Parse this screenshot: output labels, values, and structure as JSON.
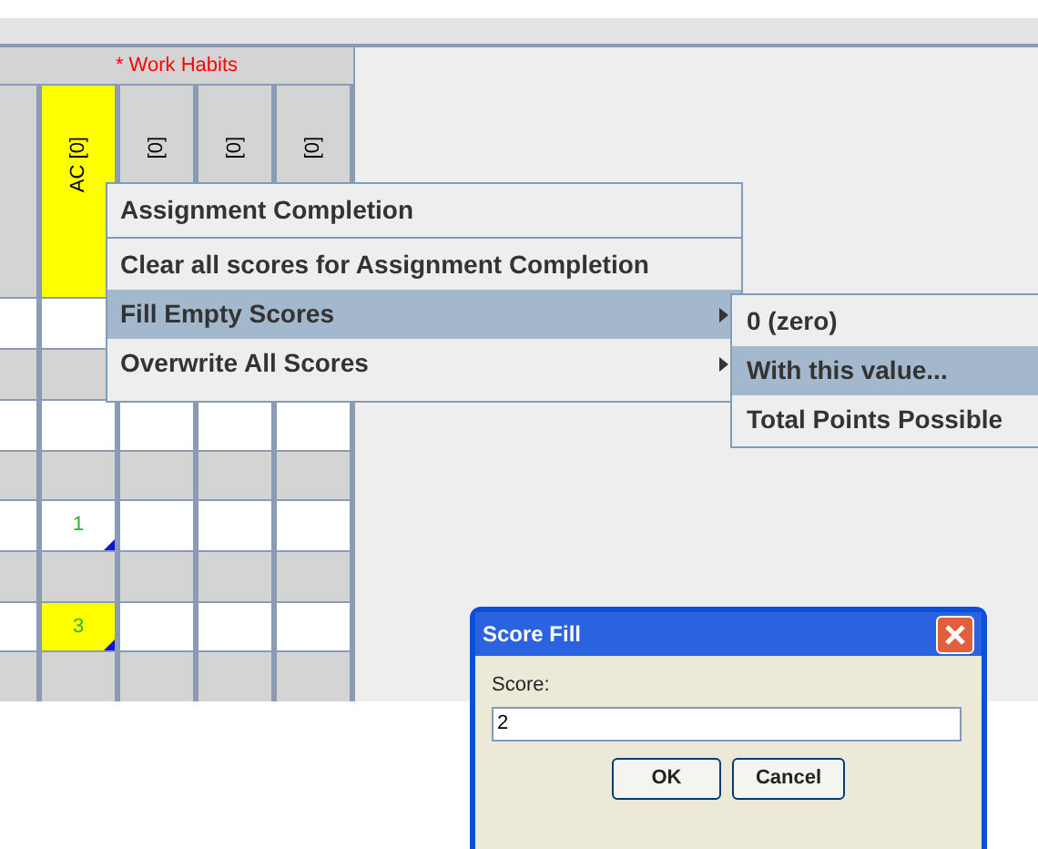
{
  "gradebook": {
    "category": "* Work Habits",
    "columns": [
      {
        "highlighted": false
      },
      {
        "label": "AC [0]",
        "highlighted": true
      },
      {
        "label": "[0]",
        "highlighted": false
      },
      {
        "label": "[0]",
        "highlighted": false
      },
      {
        "label": "[0]",
        "highlighted": false
      }
    ],
    "rows": [
      {
        "cells": [
          {
            "highlighted": false,
            "flagged": false
          },
          {},
          {},
          {},
          {}
        ]
      },
      {
        "cells": [
          {
            "highlighted": false,
            "flagged": false
          },
          {},
          {},
          {},
          {}
        ]
      },
      {
        "cells": [
          {
            "highlighted": false,
            "flagged": false
          },
          {
            "highlighted": false,
            "flagged": false
          },
          {
            "highlighted": false,
            "flagged": false
          },
          {
            "highlighted": false,
            "flagged": false
          },
          {
            "highlighted": false,
            "flagged": false
          }
        ]
      },
      {
        "cells": [
          {
            "highlighted": false,
            "flagged": false
          },
          {
            "highlighted": false,
            "flagged": false
          },
          {
            "highlighted": false,
            "flagged": false
          },
          {
            "highlighted": false,
            "flagged": false
          },
          {
            "highlighted": false,
            "flagged": false
          }
        ]
      },
      {
        "cells": [
          {
            "highlighted": false,
            "flagged": false
          },
          {
            "text": "1",
            "highlighted": false,
            "flagged": true
          },
          {
            "highlighted": false,
            "flagged": false
          },
          {
            "highlighted": false,
            "flagged": false
          },
          {
            "highlighted": false,
            "flagged": false
          }
        ]
      },
      {
        "cells": [
          {
            "highlighted": false,
            "flagged": false
          },
          {
            "highlighted": false,
            "flagged": false
          },
          {
            "highlighted": false,
            "flagged": false
          },
          {
            "highlighted": false,
            "flagged": false
          },
          {
            "highlighted": false,
            "flagged": false
          }
        ]
      },
      {
        "cells": [
          {
            "highlighted": false,
            "flagged": false
          },
          {
            "text": "3",
            "highlighted": true,
            "flagged": true
          },
          {
            "highlighted": false,
            "flagged": false
          },
          {
            "highlighted": false,
            "flagged": false
          },
          {
            "highlighted": false,
            "flagged": false
          }
        ]
      },
      {
        "cells": [
          {
            "highlighted": false,
            "flagged": false
          },
          {
            "highlighted": false,
            "flagged": false
          },
          {
            "highlighted": false,
            "flagged": false
          },
          {
            "highlighted": false,
            "flagged": false
          },
          {
            "highlighted": false,
            "flagged": false
          }
        ]
      }
    ]
  },
  "context_menu": {
    "items": [
      {
        "kind": "item",
        "label": "Assignment Completion",
        "selected": false,
        "submenu": false
      },
      {
        "kind": "separator"
      },
      {
        "kind": "item",
        "label": "Clear all scores for Assignment Completion",
        "selected": false,
        "submenu": false
      },
      {
        "kind": "item",
        "label": "Fill Empty Scores",
        "selected": true,
        "submenu": true
      },
      {
        "kind": "item",
        "label": "Overwrite All Scores",
        "selected": false,
        "submenu": true
      }
    ]
  },
  "submenu": {
    "items": [
      {
        "label": "0 (zero)",
        "selected": false
      },
      {
        "label": "With this value...",
        "selected": true
      },
      {
        "label": "Total Points Possible",
        "selected": false
      }
    ]
  },
  "dialog": {
    "title": "Score Fill",
    "field_label": "Score:",
    "value": "2",
    "buttons": [
      "OK",
      "Cancel"
    ]
  }
}
